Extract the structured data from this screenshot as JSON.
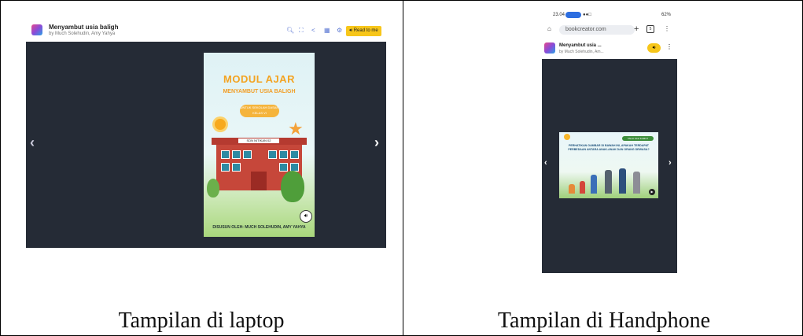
{
  "laptop": {
    "app_title": "Menyambut usia baligh",
    "app_author": "by Much Solehudin, Amy Yahya",
    "toolbar": {
      "zoom_icon": "zoom-icon",
      "fullscreen_icon": "fullscreen-icon",
      "share_icon": "share-icon",
      "grid_icon": "grid-icon",
      "settings_icon": "gear-icon",
      "read_button": "Read to me"
    },
    "cover": {
      "title": "MODUL AJAR",
      "subtitle": "MENYAMBUT USIA BALIGH",
      "badge_line1": "UNTUK SEKOLAH DASAR",
      "badge_line2": "KELAS VI",
      "school_name": "SDN NITIKAN 02",
      "author_line": "DISUSUN OLEH: MUCH SOLEHUDIN, AMY YAHYA"
    }
  },
  "phone": {
    "status_time": "23.04",
    "status_right": "62%",
    "url": "bookcreator.com",
    "tab_count": "5",
    "app_title": "Menyambut usia ...",
    "app_author": "by Much Solehudin, Am...",
    "page": {
      "tag": "TAHU KAH KAMU?",
      "text": "PERHATIKAN GAMBAR DI BAWAH INI, APAKAH TERDAPAT PERBEDAAN ANTARA ANAK-ANAK DAN ORANG DEWASA?"
    }
  },
  "captions": {
    "laptop": "Tampilan di laptop",
    "phone": "Tampilan di Handphone"
  },
  "colors": {
    "accent": "#f7c61a",
    "dark_bg": "#252b36",
    "icon_blue": "#5d79d4"
  }
}
